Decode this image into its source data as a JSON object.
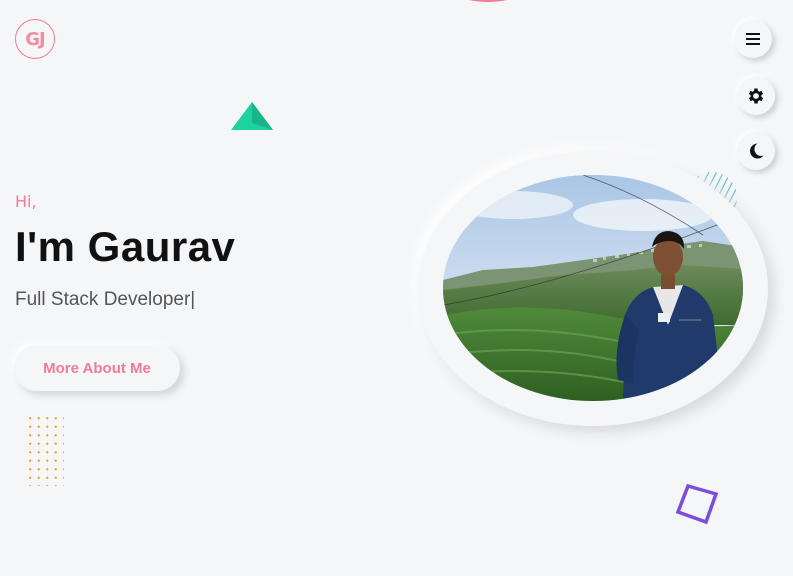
{
  "logo": {
    "text": "GJ"
  },
  "nav": {
    "menu_icon": "hamburger-menu-icon",
    "settings_icon": "gear-icon",
    "theme_icon": "moon-icon"
  },
  "hero": {
    "greeting": "Hi,",
    "name": "I'm Gaurav",
    "role": "Full Stack Developer|",
    "cta_label": "More About Me"
  },
  "profile_photo": {
    "alt": "Gaurav standing in a hillside tea garden"
  },
  "colors": {
    "accent_pink": "#f27b96",
    "teal": "#22c89a",
    "orange_dots": "#f3a230",
    "purple": "#7c4ddb",
    "text_dark": "#111111",
    "background": "#f5f6f8"
  }
}
